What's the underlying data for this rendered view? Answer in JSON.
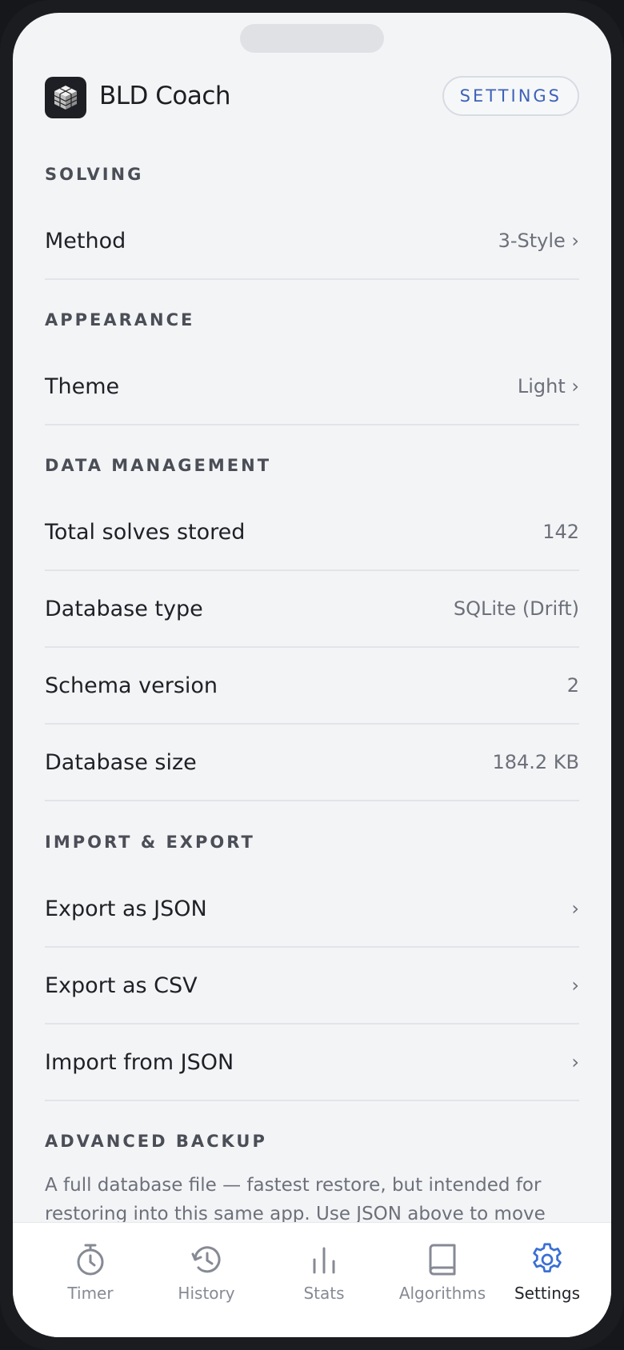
{
  "header": {
    "app_name": "BLD Coach",
    "chip_label": "SETTINGS"
  },
  "sections": {
    "solving": {
      "title": "SOLVING",
      "method": {
        "label": "Method",
        "value": "3-Style ›"
      }
    },
    "appearance": {
      "title": "APPEARANCE",
      "theme": {
        "label": "Theme",
        "value": "Light ›"
      }
    },
    "data": {
      "title": "DATA MANAGEMENT",
      "total": {
        "label": "Total solves stored",
        "value": "142"
      },
      "dbtype": {
        "label": "Database type",
        "value": "SQLite (Drift)"
      },
      "schema": {
        "label": "Schema version",
        "value": "2"
      },
      "dbsize": {
        "label": "Database size",
        "value": "184.2 KB"
      }
    },
    "importexport": {
      "title": "IMPORT & EXPORT",
      "export_json": {
        "label": "Export as JSON",
        "value": "›"
      },
      "export_csv": {
        "label": "Export as CSV",
        "value": "›"
      },
      "import_json": {
        "label": "Import from JSON",
        "value": "›"
      }
    },
    "advanced": {
      "title": "ADVANCED BACKUP",
      "description": "A full database file — fastest restore, but intended for restoring into this same app. Use JSON above to move data to"
    }
  },
  "tabs": [
    {
      "label": "Timer",
      "icon": "timer-icon"
    },
    {
      "label": "History",
      "icon": "history-icon"
    },
    {
      "label": "Stats",
      "icon": "stats-icon"
    },
    {
      "label": "Algorithms",
      "icon": "book-icon"
    },
    {
      "label": "Settings",
      "icon": "gear-icon"
    }
  ],
  "colors": {
    "accent": "#3d62b8",
    "active_tab_icon": "#3b6fd4",
    "inactive_tab": "#868a94"
  }
}
